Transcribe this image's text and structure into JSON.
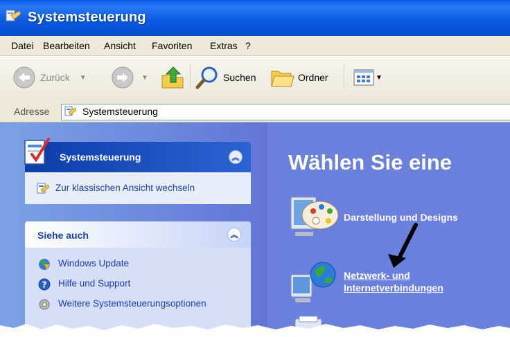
{
  "window": {
    "title": "Systemsteuerung"
  },
  "menu": {
    "items": [
      "Datei",
      "Bearbeiten",
      "Ansicht",
      "Favoriten",
      "Extras",
      "?"
    ]
  },
  "toolbar": {
    "back_label": "Zurück",
    "search_label": "Suchen",
    "folders_label": "Ordner"
  },
  "address": {
    "label": "Adresse",
    "value": "Systemsteuerung"
  },
  "task_panel": {
    "title": "Systemsteuerung",
    "switch_view_label": "Zur klassischen Ansicht wechseln"
  },
  "see_also": {
    "title": "Siehe auch",
    "items": [
      "Windows Update",
      "Hilfe und Support",
      "Weitere Systemsteuerungsoptionen"
    ]
  },
  "main": {
    "heading": "Wählen Sie eine",
    "categories": [
      {
        "label": "Darstellung und Designs"
      },
      {
        "label": "Netzwerk- und Internetverbindungen"
      }
    ]
  }
}
